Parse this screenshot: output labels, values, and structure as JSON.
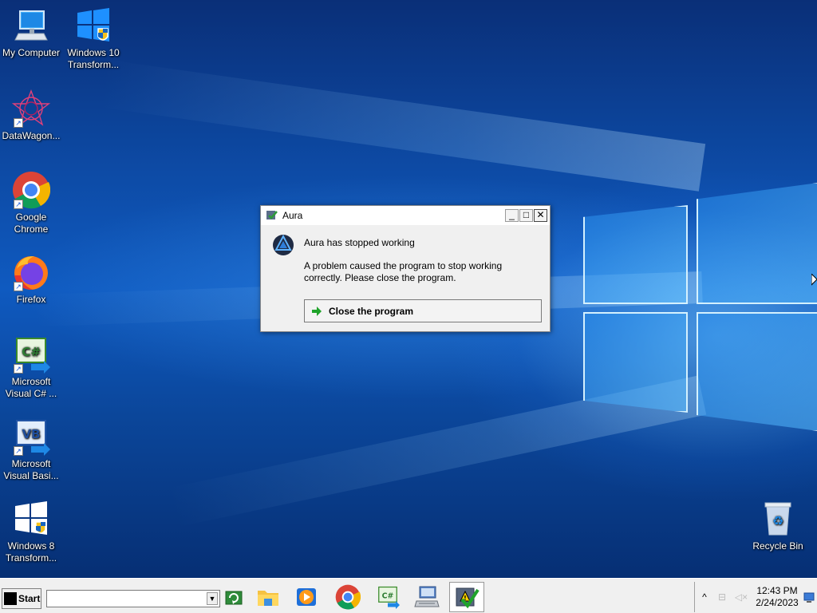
{
  "desktop": {
    "icons": [
      {
        "label": "My Computer",
        "icon": "computer-icon"
      },
      {
        "label": "Windows 10 Transform...",
        "icon": "windows-shield-icon"
      },
      {
        "label": "DataWagon...",
        "icon": "datawagon-icon"
      },
      {
        "label": "Google Chrome",
        "icon": "chrome-icon"
      },
      {
        "label": "Firefox",
        "icon": "firefox-icon"
      },
      {
        "label": "Microsoft Visual C# ...",
        "icon": "csharp-icon"
      },
      {
        "label": "Microsoft Visual Basi...",
        "icon": "vb-icon"
      },
      {
        "label": "Windows 8 Transform...",
        "icon": "windows-shield-icon"
      },
      {
        "label": "Recycle Bin",
        "icon": "recycle-bin-icon"
      }
    ]
  },
  "dialog": {
    "title": "Aura",
    "heading": "Aura has stopped working",
    "message": "A problem caused the program to stop working correctly. Please close the program.",
    "action_label": "Close the program",
    "controls": {
      "minimize": "_",
      "maximize": "□",
      "close": "✕"
    }
  },
  "taskbar": {
    "start_label": "Start",
    "run_value": "",
    "apps": [
      {
        "name": "file-explorer",
        "icon": "folder-icon",
        "active": false
      },
      {
        "name": "media-player",
        "icon": "media-player-icon",
        "active": false
      },
      {
        "name": "chrome",
        "icon": "chrome-icon",
        "active": false
      },
      {
        "name": "visual-csharp",
        "icon": "csharp-icon",
        "active": false
      },
      {
        "name": "remote-desktop",
        "icon": "computer-keyboard-icon",
        "active": false
      },
      {
        "name": "aura",
        "icon": "aura-check-icon",
        "active": true
      }
    ],
    "tray": {
      "chevron": "^",
      "time": "12:43 PM",
      "date": "2/24/2023"
    }
  },
  "colors": {
    "desktop_blue": "#0f5ac0",
    "taskbar_bg": "#f0f0f0",
    "dialog_bg": "#f0f0f0",
    "action_arrow": "#1fa32a"
  }
}
